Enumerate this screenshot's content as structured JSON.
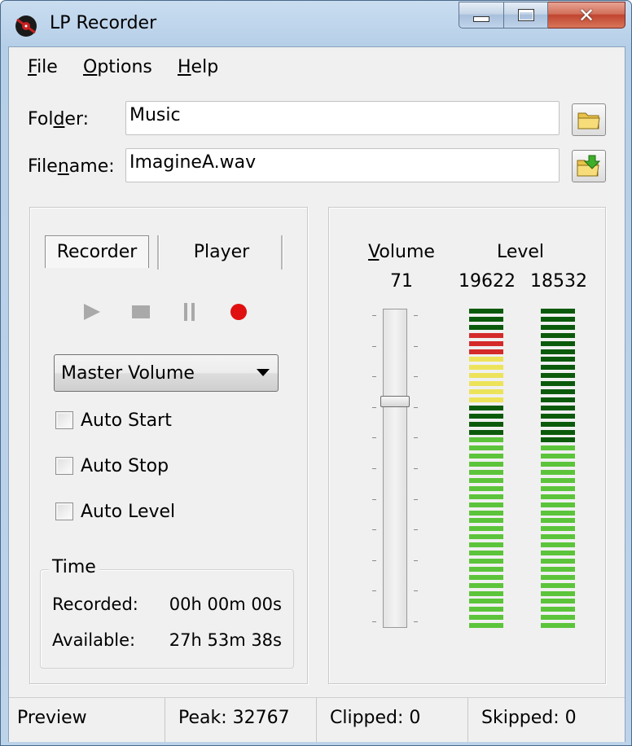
{
  "window": {
    "title": "LP Recorder",
    "accent": "#b6cfe8",
    "close_color": "#c14530"
  },
  "menu": {
    "items": [
      {
        "acc": "F",
        "rest": "ile"
      },
      {
        "acc": "O",
        "rest": "ptions"
      },
      {
        "acc": "H",
        "rest": "elp"
      }
    ]
  },
  "fields": {
    "folder_label_pre": "Fol",
    "folder_label_acc": "d",
    "folder_label_post": "er:",
    "folder_value": "Music",
    "filename_label_pre": "File",
    "filename_label_acc": "n",
    "filename_label_post": "ame:",
    "filename_value": "ImagineA.wav",
    "folder_icon": "folder-icon",
    "save_icon": "folder-save-icon"
  },
  "tabs": {
    "recorder": "Recorder",
    "player": "Player",
    "active": "Recorder"
  },
  "transport": {
    "play_icon": "play-icon",
    "stop_icon": "stop-icon",
    "pause_icon": "pause-icon",
    "record_icon": "record-icon",
    "record_color": "#e01010"
  },
  "source": {
    "selected": "Master Volume"
  },
  "options": {
    "auto_start": "Auto Start",
    "auto_stop": "Auto Stop",
    "auto_level": "Auto Level"
  },
  "time": {
    "title": "Time",
    "recorded_label": "Recorded:",
    "recorded_value": "00h 00m 00s",
    "available_label": "Available:",
    "available_value": "27h 53m 38s"
  },
  "volume": {
    "label_acc": "V",
    "label_rest": "olume",
    "value": "71",
    "level_fraction": 0.71
  },
  "level": {
    "label": "Level",
    "left_value": "19622",
    "right_value": "18532",
    "peak_max": 32767,
    "left_peak_value": 32767,
    "right_peak_value": 18532,
    "left_level": 19622,
    "right_level": 18532,
    "colors": {
      "green": "#5cc43a",
      "yellow": "#ece35a",
      "red": "#d42a2a",
      "dark_green": "#0b5a0b"
    }
  },
  "status": {
    "preview": "Preview",
    "peak": "Peak: 32767",
    "clipped": "Clipped: 0",
    "skipped": "Skipped: 0"
  }
}
